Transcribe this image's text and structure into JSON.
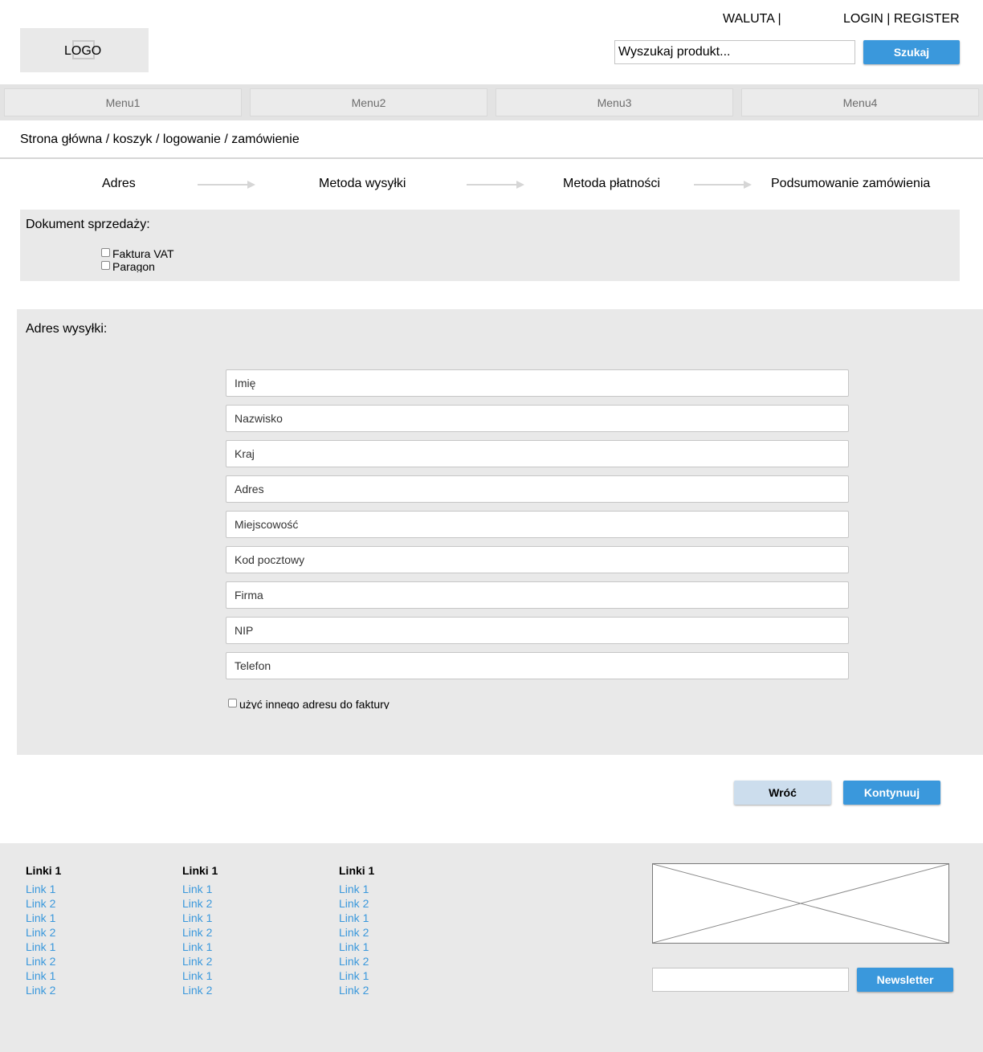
{
  "header": {
    "currency_label": "WALUTA |",
    "login_register": "LOGIN | REGISTER",
    "logo_text": "LOGO",
    "search_placeholder": "Wyszukaj produkt...",
    "search_button": "Szukaj"
  },
  "menu": {
    "items": [
      {
        "label": "Menu1"
      },
      {
        "label": "Menu2"
      },
      {
        "label": "Menu3"
      },
      {
        "label": "Menu4"
      }
    ]
  },
  "breadcrumb": "Strona główna / koszyk / logowanie / zamówienie",
  "steps": [
    {
      "label": "Adres"
    },
    {
      "label": "Metoda wysyłki"
    },
    {
      "label": "Metoda płatności"
    },
    {
      "label": "Podsumowanie zamówienia"
    }
  ],
  "sales_document": {
    "title": "Dokument sprzedaży:",
    "options": [
      {
        "label": "Faktura VAT",
        "checked": false
      },
      {
        "label": "Paragon",
        "checked": false
      }
    ]
  },
  "shipping_address": {
    "title": "Adres wysyłki:",
    "fields": [
      {
        "placeholder": "Imię"
      },
      {
        "placeholder": "Nazwisko"
      },
      {
        "placeholder": "Kraj"
      },
      {
        "placeholder": "Adres"
      },
      {
        "placeholder": "Miejscowość"
      },
      {
        "placeholder": "Kod pocztowy"
      },
      {
        "placeholder": "Firma"
      },
      {
        "placeholder": "NIP"
      },
      {
        "placeholder": "Telefon"
      }
    ],
    "other_invoice_address": "użyć innego adresu do faktury"
  },
  "actions": {
    "back": "Wróć",
    "continue": "Kontynuuj"
  },
  "footer": {
    "columns": [
      {
        "title": "Linki 1",
        "links": [
          "Link 1",
          "Link 2",
          "Link 1",
          "Link 2",
          "Link 1",
          "Link 2",
          "Link 1",
          "Link 2"
        ]
      },
      {
        "title": "Linki 1",
        "links": [
          "Link 1",
          "Link 2",
          "Link 1",
          "Link 2",
          "Link 1",
          "Link 2",
          "Link 1",
          "Link 2"
        ]
      },
      {
        "title": "Linki 1",
        "links": [
          "Link 1",
          "Link 2",
          "Link 1",
          "Link 2",
          "Link 1",
          "Link 2",
          "Link 1",
          "Link 2"
        ]
      }
    ],
    "newsletter_button": "Newsletter"
  },
  "colors": {
    "accent": "#3a98dc",
    "secondary_button": "#ccdded",
    "panel": "#e9e9e9"
  }
}
